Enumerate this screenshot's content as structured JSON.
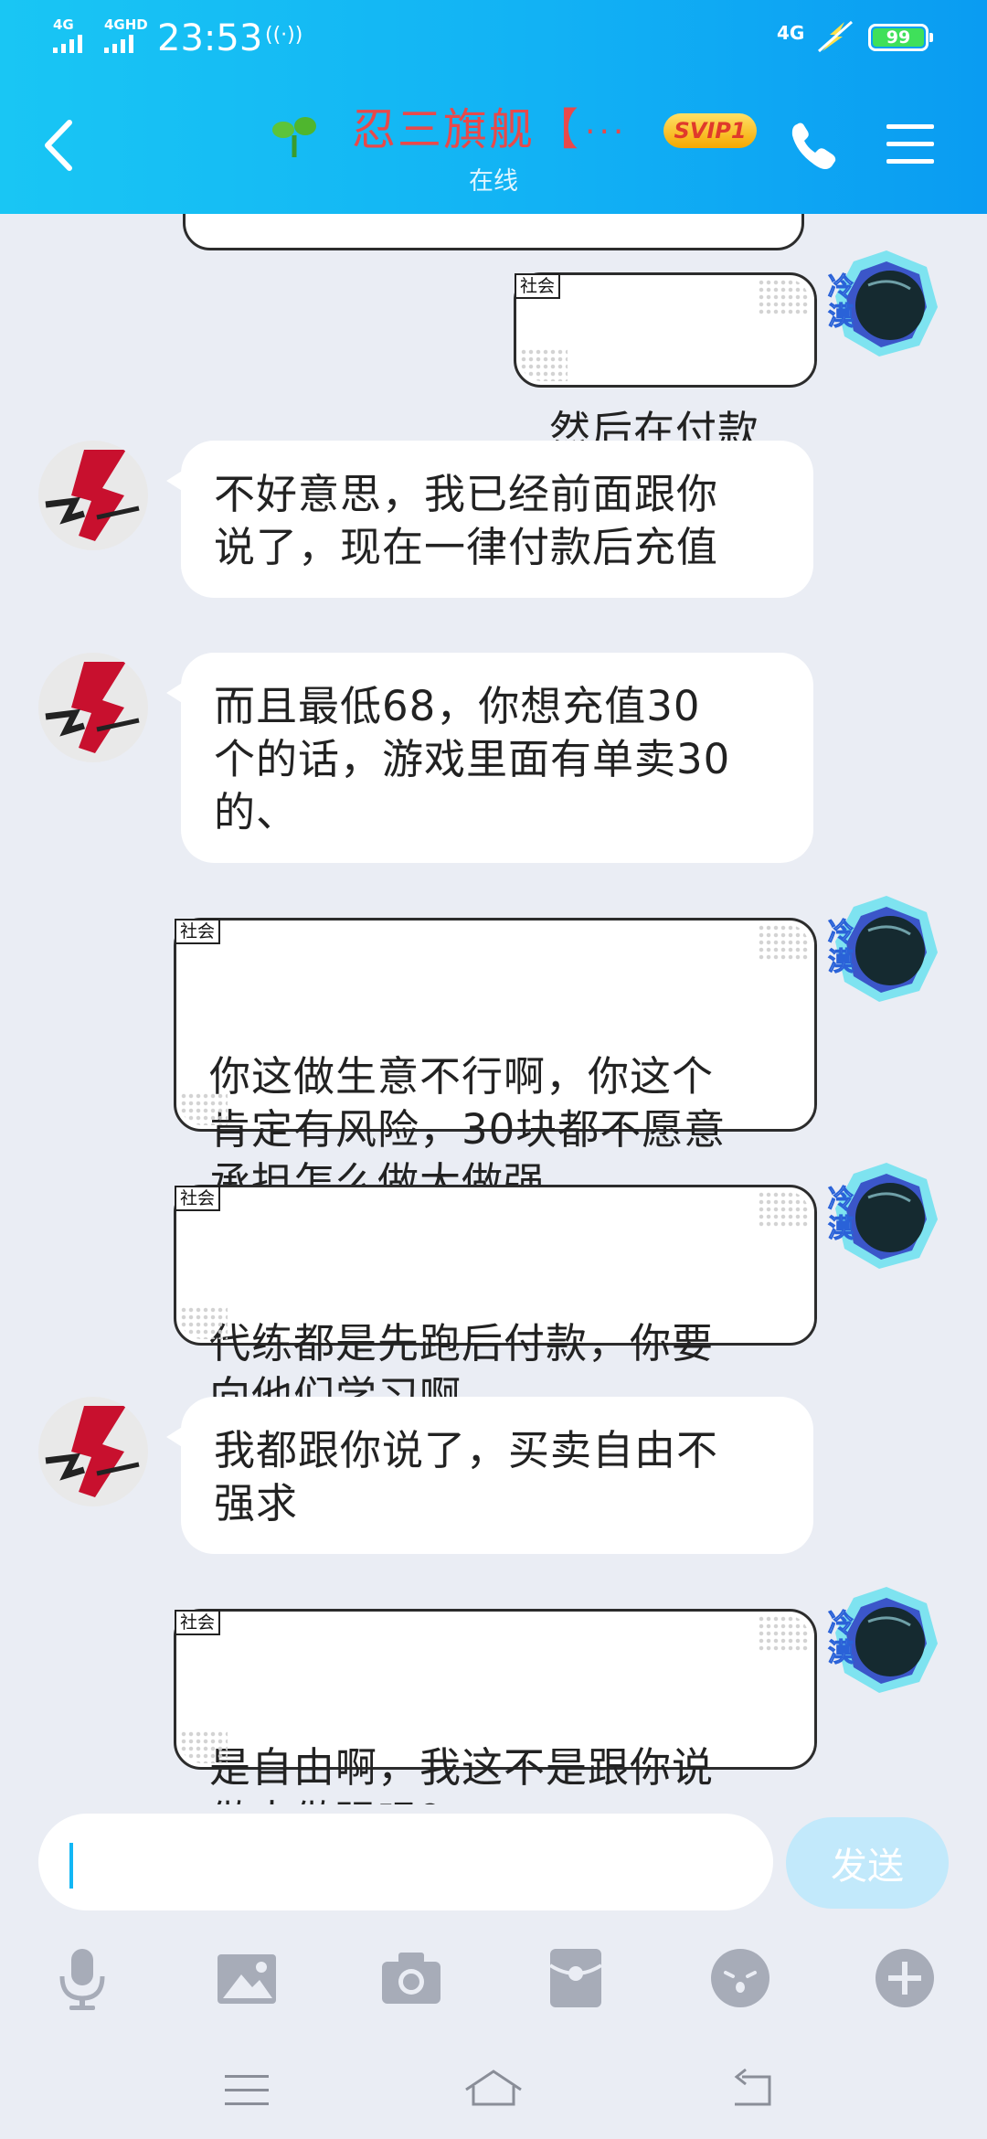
{
  "status_bar": {
    "sim1_label": "4G",
    "sim2_label": "4GHD",
    "time": "23:53",
    "vibrate_symbol": "((·))",
    "network_label": "4G",
    "battery": "99",
    "battery_color": "#3fe05a"
  },
  "header": {
    "title": "忍三旗舰【",
    "title_overflow": "···",
    "badge": "SVIP1",
    "subtitle": "在线",
    "accent": "#12b7f5",
    "title_color": "#e8494a"
  },
  "messages": [
    {
      "direction": "out",
      "tag": "社会",
      "text": "然后在付款"
    },
    {
      "direction": "in",
      "text": "不好意思，我已经前面跟你\n说了，现在一律付款后充值"
    },
    {
      "direction": "in",
      "text": "而且最低68，你想充值30\n个的话，游戏里面有单卖30\n的、"
    },
    {
      "direction": "out",
      "tag": "社会",
      "text": "你这做生意不行啊，你这个\n肯定有风险，30块都不愿意\n承担怎么做大做强。"
    },
    {
      "direction": "out",
      "tag": "社会",
      "text": "代练都是先跑后付款，你要\n向他们学习啊。"
    },
    {
      "direction": "in",
      "text": "我都跟你说了，买卖自由不\n强求"
    },
    {
      "direction": "out",
      "tag": "社会",
      "text": "是自由啊，我这不是跟你说\n做大做强吗？"
    }
  ],
  "avatars": {
    "self_label": "冷漠"
  },
  "composer": {
    "value": "",
    "send_label": "发送"
  },
  "toolbar_icons": [
    "microphone-icon",
    "image-icon",
    "camera-icon",
    "red-packet-icon",
    "emoji-icon",
    "plus-icon"
  ],
  "system_nav_icons": [
    "recents-icon",
    "home-icon",
    "back-icon"
  ]
}
